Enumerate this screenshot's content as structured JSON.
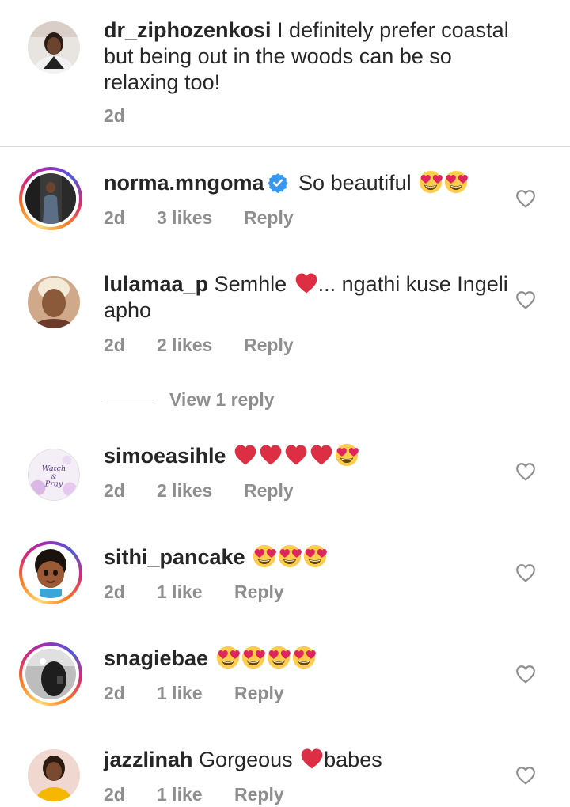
{
  "comments": [
    {
      "username": "dr_ziphozenkosi",
      "text": "I definitely prefer coastal but being out in the woods can be so relaxing too!",
      "time": "2d"
    },
    {
      "username": "norma.mngoma",
      "verified": true,
      "text": "So beautiful",
      "emojis": [
        "heart-eyes",
        "heart-eyes"
      ],
      "time": "2d",
      "likes": "3 likes",
      "reply": "Reply"
    },
    {
      "username": "lulamaa_p",
      "text_before": "Semhle",
      "text_after": "... ngathi kuse Ingeli apho",
      "emojis": [
        "red-heart"
      ],
      "time": "2d",
      "likes": "2 likes",
      "reply": "Reply",
      "view_replies": "View 1 reply"
    },
    {
      "username": "simoeasihle",
      "emojis": [
        "red-heart",
        "red-heart",
        "red-heart",
        "red-heart",
        "heart-eyes"
      ],
      "avatar_text_1": "Watch",
      "avatar_text_2": "&",
      "avatar_text_3": "Pray",
      "time": "2d",
      "likes": "2 likes",
      "reply": "Reply"
    },
    {
      "username": "sithi_pancake",
      "emojis": [
        "heart-eyes",
        "heart-eyes",
        "heart-eyes"
      ],
      "time": "2d",
      "likes": "1 like",
      "reply": "Reply"
    },
    {
      "username": "snagiebae",
      "emojis": [
        "heart-eyes",
        "heart-eyes",
        "heart-eyes",
        "heart-eyes"
      ],
      "time": "2d",
      "likes": "1 like",
      "reply": "Reply"
    },
    {
      "username": "jazzlinah",
      "text_before": "Gorgeous",
      "text_after": "babes",
      "emojis": [
        "red-heart"
      ],
      "time": "2d",
      "likes": "1 like",
      "reply": "Reply"
    }
  ],
  "colors": {
    "text": "#262626",
    "meta": "#8e8e8e",
    "verified": "#3897f0",
    "heart": "#e0245e",
    "emoji_face": "#ffcc4d"
  }
}
